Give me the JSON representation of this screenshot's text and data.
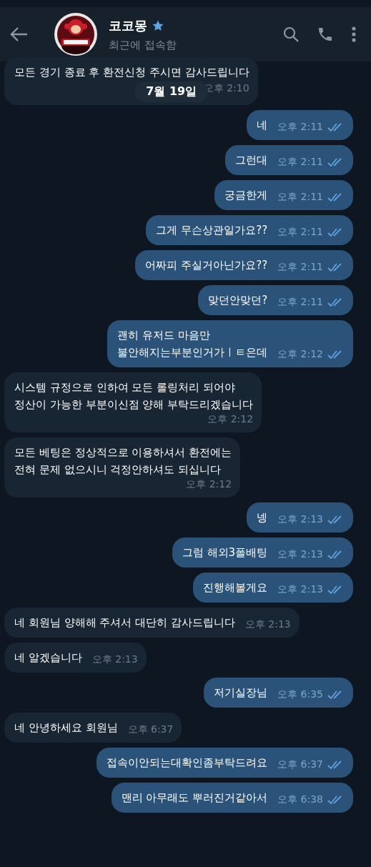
{
  "header": {
    "title": "코코몽",
    "verified": true,
    "status": "최근에 접속함"
  },
  "date_pill": "7월 19일",
  "messages": [
    {
      "kind": "in",
      "text": "모든 경기 종료 후 환전신청 주시면 감사드립니다",
      "time": "오후 2:10"
    },
    {
      "kind": "out",
      "text": "네",
      "time": "오후 2:11",
      "read": true
    },
    {
      "kind": "out",
      "text": "그런대",
      "time": "오후 2:11",
      "read": true
    },
    {
      "kind": "out",
      "text": "궁금한게",
      "time": "오후 2:11",
      "read": true
    },
    {
      "kind": "out",
      "text": "그게 무슨상관일가요??",
      "time": "오후 2:11",
      "read": true
    },
    {
      "kind": "out",
      "text": "어짜피 주실거아닌가요??",
      "time": "오후 2:11",
      "read": true
    },
    {
      "kind": "out",
      "text": "맞던안맞던?",
      "time": "오후 2:11",
      "read": true
    },
    {
      "kind": "out",
      "text": "괜히 유저드 마음만\n불안해지는부분인거가ㅣㅌ은데",
      "time": "오후 2:12",
      "read": true
    },
    {
      "kind": "in",
      "text": "시스템 규정으로 인하여 모든 롤링처리 되어야\n정산이 가능한 부분이신점 양해 부탁드리겠습니다",
      "time": "오후 2:12"
    },
    {
      "kind": "in",
      "text": "모든 베팅은 정상적으로 이용하셔서 환전에는\n전혀 문제 없으시니 걱정안하셔도 되십니다",
      "time": "오후 2:12"
    },
    {
      "kind": "out",
      "text": "넹",
      "time": "오후 2:13",
      "read": true
    },
    {
      "kind": "out",
      "text": "그럼 해외3폴배팅",
      "time": "오후 2:13",
      "read": true
    },
    {
      "kind": "out",
      "text": "진행해볼게요",
      "time": "오후 2:13",
      "read": true
    },
    {
      "kind": "in",
      "text": "네 회원님 양해해 주셔서 대단히 감사드립니다",
      "time": "오후 2:13"
    },
    {
      "kind": "in",
      "text": "네 알겠습니다",
      "time": "오후 2:13"
    },
    {
      "kind": "out",
      "text": "저기실장님",
      "time": "오후 6:35",
      "read": true
    },
    {
      "kind": "in",
      "text": "네 안녕하세요 회원님",
      "time": "오후 6:37"
    },
    {
      "kind": "out",
      "text": "접속이안되는대확인좀부탁드려요",
      "time": "오후 6:37",
      "read": true
    },
    {
      "kind": "out",
      "text": "맨리 아무래도 뿌러진거같아서",
      "time": "오후 6:38",
      "read": true
    }
  ]
}
